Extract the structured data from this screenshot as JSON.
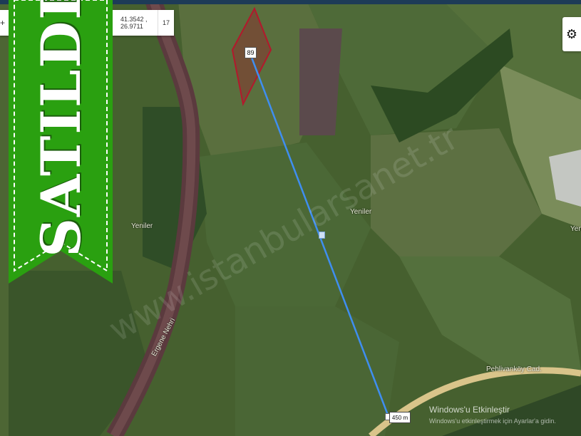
{
  "topbar": {
    "color": "#1d3b57"
  },
  "coordinates": {
    "plus_glyph": "+",
    "latlng": "41.3542 , 26.9711",
    "zoom": "17"
  },
  "settings": {
    "icon": "gear-icon"
  },
  "banner": {
    "text": "SATILDI",
    "color": "#2aa010"
  },
  "parcel": {
    "number": "89",
    "outline_color": "#b3182c"
  },
  "measure": {
    "distance": "450 m",
    "line_color": "#3f8ef0"
  },
  "labels": {
    "river": "Ergene Nehri",
    "yeniler_left": "Yeniler",
    "yeniler_mid": "Yeniler",
    "yeniler_right": "Yeniler",
    "road": "Pehlivanköy Cad."
  },
  "watermark": "www.istanbularsanet.tr",
  "windows_notice": {
    "line1": "Windows'u Etkinleştir",
    "line2": "Windows'u etkinleştirmek için Ayarlar'a gidin."
  }
}
